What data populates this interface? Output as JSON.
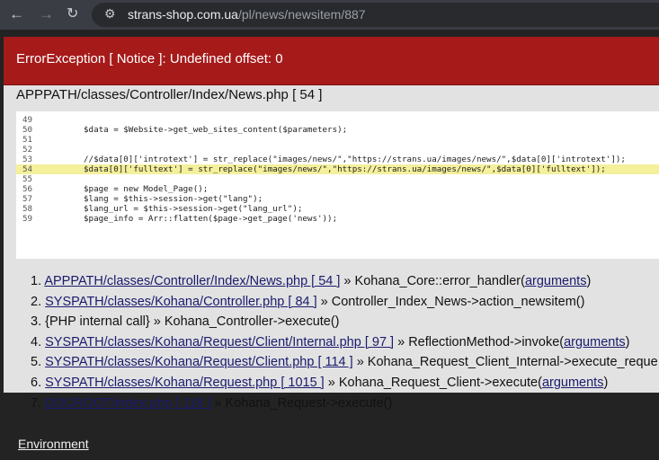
{
  "browser": {
    "back_icon": "arrow-left-icon",
    "forward_icon": "arrow-right-icon",
    "reload_icon": "reload-icon",
    "site_info_icon": "tune-icon",
    "url_host": "strans-shop.com.ua",
    "url_path": "/pl/news/newsitem/887"
  },
  "error": {
    "title": "ErrorException [ Notice ]: Undefined offset: 0",
    "file": "APPPATH/classes/Controller/Index/News.php [ 54 ]",
    "code_lines": [
      {
        "num": "49",
        "text": ""
      },
      {
        "num": "50",
        "text": "$data = $Website->get_web_sites_content($parameters);"
      },
      {
        "num": "51",
        "text": ""
      },
      {
        "num": "52",
        "text": ""
      },
      {
        "num": "53",
        "text": "//$data[0]['introtext'] = str_replace(\"images/news/\",\"https://strans.ua/images/news/\",$data[0]['introtext']);"
      },
      {
        "num": "54",
        "text": "$data[0]['fulltext'] = str_replace(\"images/news/\",\"https://strans.ua/images/news/\",$data[0]['fulltext']);"
      },
      {
        "num": "55",
        "text": ""
      },
      {
        "num": "56",
        "text": "$page = new Model_Page();"
      },
      {
        "num": "57",
        "text": "$lang = $this->session->get(\"lang\");"
      },
      {
        "num": "58",
        "text": "$lang_url = $this->session->get(\"lang_url\");"
      },
      {
        "num": "59",
        "text": "$page_info = Arr::flatten($page->get_page('news'));"
      }
    ],
    "trace": [
      {
        "n": "1.",
        "link": "APPPATH/classes/Controller/Index/News.php [ 54 ]",
        "text": " » Kohana_Core::error_handler(",
        "args": "arguments",
        "end": ")"
      },
      {
        "n": "2.",
        "link": "SYSPATH/classes/Kohana/Controller.php [ 84 ]",
        "text": " » Controller_Index_News->action_newsitem()",
        "args": "",
        "end": ""
      },
      {
        "n": "3.",
        "link": "",
        "text": "{PHP internal call} » Kohana_Controller->execute()",
        "args": "",
        "end": ""
      },
      {
        "n": "4.",
        "link": "SYSPATH/classes/Kohana/Request/Client/Internal.php [ 97 ]",
        "text": " » ReflectionMethod->invoke(",
        "args": "arguments",
        "end": ")"
      },
      {
        "n": "5.",
        "link": "SYSPATH/classes/Kohana/Request/Client.php [ 114 ]",
        "text": " » Kohana_Request_Client_Internal->execute_reque",
        "args": "",
        "end": ""
      },
      {
        "n": "6.",
        "link": "SYSPATH/classes/Kohana/Request.php [ 1015 ]",
        "text": " » Kohana_Request_Client->execute(",
        "args": "arguments",
        "end": ")"
      },
      {
        "n": "7.",
        "link": "DOCROOT/index.php [ 118 ]",
        "text": " » Kohana_Request->execute()",
        "args": "",
        "end": ""
      }
    ]
  },
  "environment_label": "Environment"
}
